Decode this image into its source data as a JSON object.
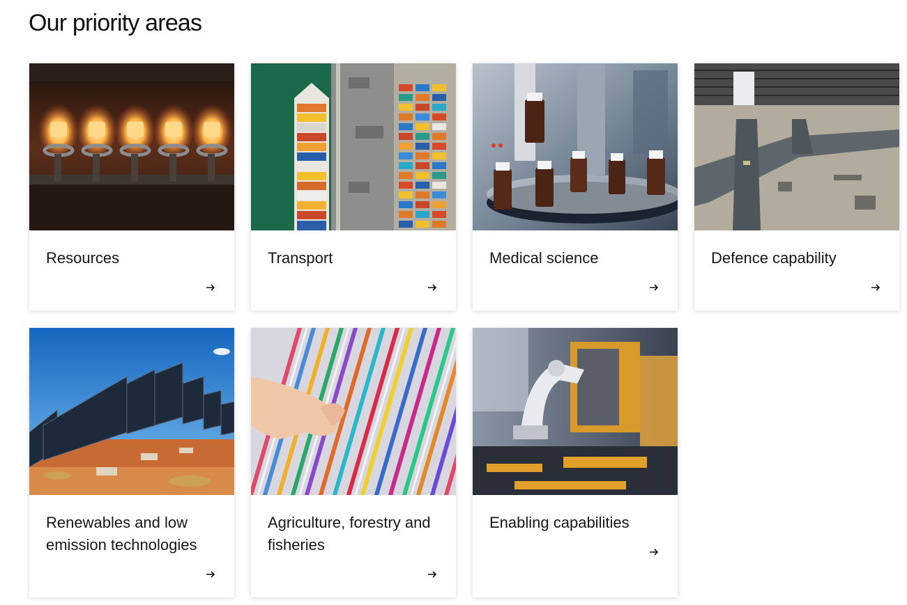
{
  "section": {
    "title": "Our priority areas"
  },
  "cards": [
    {
      "label": "Resources",
      "image": "gas-burners-photo",
      "icon": "arrow-right-icon"
    },
    {
      "label": "Transport",
      "image": "container-ship-aerial-photo",
      "icon": "arrow-right-icon"
    },
    {
      "label": "Medical science",
      "image": "lab-vials-photo",
      "icon": "arrow-right-icon"
    },
    {
      "label": "Defence capability",
      "image": "aircraft-hangar-photo",
      "icon": "arrow-right-icon"
    },
    {
      "label": "Renewables and low emission technologies",
      "image": "solar-panels-photo",
      "icon": "arrow-right-icon"
    },
    {
      "label": "Agriculture, forestry and fisheries",
      "image": "colored-fibres-photo",
      "icon": "arrow-right-icon"
    },
    {
      "label": "Enabling capabilities",
      "image": "robotic-arm-photo",
      "icon": "arrow-right-icon"
    }
  ]
}
